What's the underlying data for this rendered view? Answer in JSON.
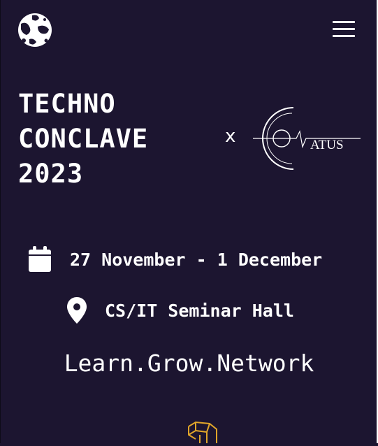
{
  "header": {
    "logo_icon": "planet-logo-icon",
    "menu_icon": "hamburger-menu-icon"
  },
  "hero": {
    "title_lines": [
      "TECHNO",
      "CONCLAVE",
      "2023"
    ],
    "collab_symbol": "x",
    "partner_logo_text": "ATUS"
  },
  "event": {
    "date_icon": "calendar-icon",
    "date": "27 November - 1 December",
    "venue_icon": "location-pin-icon",
    "venue": "CS/IT Seminar Hall"
  },
  "tagline": "Learn.Grow.Network",
  "decor": {
    "icon": "gear-3d-outline-icon",
    "accent_color": "#e0a52a"
  },
  "colors": {
    "background": "#1c1530",
    "text": "#ffffff"
  }
}
